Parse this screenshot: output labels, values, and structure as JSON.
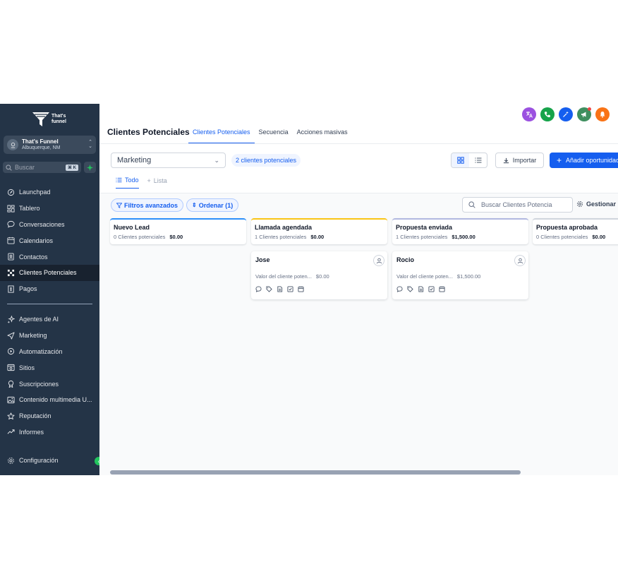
{
  "brand": {
    "name_line1": "That's",
    "name_line2": "funnel"
  },
  "account": {
    "name": "That's Funnel",
    "location": "Albuquerque, NM"
  },
  "search": {
    "placeholder": "Buscar",
    "shortcut": "⌘ K"
  },
  "sidebar": {
    "items": [
      {
        "label": "Launchpad",
        "icon": "rocket-icon"
      },
      {
        "label": "Tablero",
        "icon": "dashboard-icon"
      },
      {
        "label": "Conversaciones",
        "icon": "chat-icon"
      },
      {
        "label": "Calendarios",
        "icon": "calendar-icon"
      },
      {
        "label": "Contactos",
        "icon": "contacts-icon"
      },
      {
        "label": "Clientes Potenciales",
        "icon": "pipeline-icon",
        "active": true
      },
      {
        "label": "Pagos",
        "icon": "payments-icon"
      }
    ],
    "items2": [
      {
        "label": "Agentes de AI",
        "icon": "sparkle-icon"
      },
      {
        "label": "Marketing",
        "icon": "send-icon"
      },
      {
        "label": "Automatización",
        "icon": "automation-icon"
      },
      {
        "label": "Sitios",
        "icon": "sites-icon"
      },
      {
        "label": "Suscripciones",
        "icon": "memberships-icon"
      },
      {
        "label": "Contenido multimedia U...",
        "icon": "media-icon"
      },
      {
        "label": "Reputación",
        "icon": "star-icon"
      },
      {
        "label": "Informes",
        "icon": "reports-icon"
      }
    ],
    "settings_label": "Configuración"
  },
  "header": {
    "title": "Clientes Potenciales",
    "tabs": [
      "Clientes Potenciales",
      "Secuencia",
      "Acciones masivas"
    ],
    "icon_colors": [
      "#9b51e0",
      "#16a34a",
      "#155eef",
      "#3f8f5f",
      "#f97316"
    ]
  },
  "toolbar": {
    "pipeline": "Marketing",
    "count_label": "2 clientes potenciales",
    "import_label": "Importar",
    "add_label": "Añadir oportunidad",
    "view_tabs": [
      "Todo",
      "Lista"
    ],
    "filters_label": "Filtros avanzados",
    "sort_label": "Ordenar (1)",
    "search_placeholder": "Buscar Clientes Potencia",
    "manage_label": "Gestionar"
  },
  "stages": [
    {
      "title": "Nuevo Lead",
      "count": "0 Clientes potenciales",
      "amount": "$0.00",
      "color": "#2e90fa"
    },
    {
      "title": "Llamada agendada",
      "count": "1 Clientes potenciales",
      "amount": "$0.00",
      "color": "#fac515"
    },
    {
      "title": "Propuesta enviada",
      "count": "1 Clientes potenciales",
      "amount": "$1,500.00",
      "color": "#b2b8e0"
    },
    {
      "title": "Propuesta aprobada",
      "count": "0 Clientes potenciales",
      "amount": "$0.00",
      "color": "#d0d5dd"
    }
  ],
  "cards": [
    {
      "name": "Jose",
      "value_label": "Valor del cliente poten...",
      "value": "$0.00"
    },
    {
      "name": "Rocio",
      "value_label": "Valor del cliente poten...",
      "value": "$1,500.00"
    }
  ]
}
